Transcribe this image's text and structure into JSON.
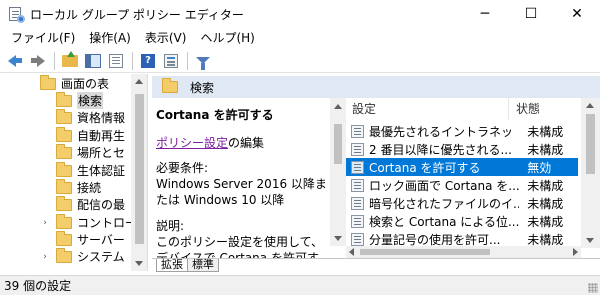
{
  "window": {
    "title": "ローカル グループ ポリシー エディター",
    "minimize": "─",
    "maximize": "☐",
    "close": "✕"
  },
  "menu": {
    "items": [
      "ファイル(F)",
      "操作(A)",
      "表示(V)",
      "ヘルプ(H)"
    ]
  },
  "toolbar": {
    "help_glyph": "?"
  },
  "tree": {
    "items": [
      {
        "label": "画面の表",
        "indent": 2,
        "chevron": ""
      },
      {
        "label": "検索",
        "indent": 2,
        "chevron": "",
        "selected": true
      },
      {
        "label": "資格情報",
        "indent": 2,
        "chevron": ""
      },
      {
        "label": "自動再生",
        "indent": 2,
        "chevron": ""
      },
      {
        "label": "場所とセ",
        "indent": 2,
        "chevron": "›"
      },
      {
        "label": "生体認証",
        "indent": 2,
        "chevron": "›"
      },
      {
        "label": "接続",
        "indent": 2,
        "chevron": ""
      },
      {
        "label": "配信の最",
        "indent": 2,
        "chevron": ""
      },
      {
        "label": "コントロール パ",
        "indent": 1,
        "chevron": "›"
      },
      {
        "label": "サーバー",
        "indent": 1,
        "chevron": ""
      },
      {
        "label": "システム",
        "indent": 1,
        "chevron": "›"
      }
    ]
  },
  "right": {
    "header": "検索",
    "description": {
      "title": "Cortana を許可する",
      "link_text": "ポリシー設定",
      "link_suffix": "の編集",
      "requirements_label": "必要条件:",
      "requirements_text": "Windows Server 2016 以降または Windows 10 以降",
      "explanation_label": "説明:",
      "explanation_text": "このポリシー設定を使用して、デバイスで Cortana を許可するかどうかを指定"
    },
    "list": {
      "col_setting": "設定",
      "col_state": "状態",
      "rows": [
        {
          "name": "最優先されるイントラネッ",
          "state": "未構成"
        },
        {
          "name": "2 番目以降に優先される...",
          "state": "未構成"
        },
        {
          "name": "Cortana を許可する",
          "state": "無効",
          "selected": true
        },
        {
          "name": "ロック画面で Cortana を...",
          "state": "未構成"
        },
        {
          "name": "暗号化されたファイルのイ...",
          "state": "未構成"
        },
        {
          "name": "検索と Cortana による位...",
          "state": "未構成"
        },
        {
          "name": "分量記号の使用を許可...",
          "state": "未構成"
        }
      ]
    },
    "tabs": [
      "拡張",
      "標準"
    ]
  },
  "status": {
    "text": "39 個の設定"
  }
}
